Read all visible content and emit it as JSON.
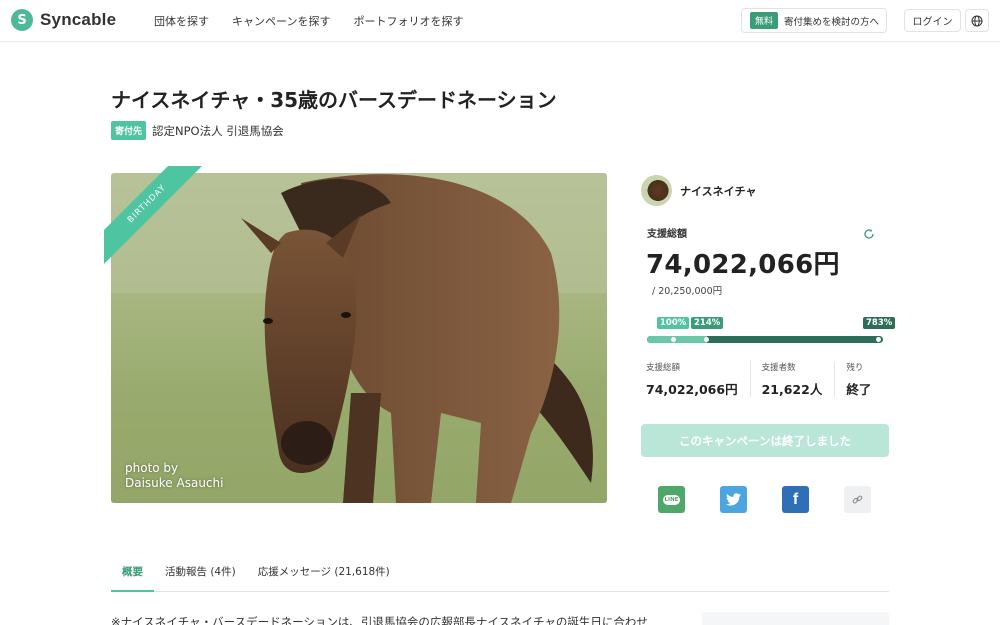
{
  "header": {
    "logo_mark": "S",
    "logo_text": "Syncable",
    "nav": [
      "団体を探す",
      "キャンペーンを探す",
      "ポートフォリオを探す"
    ],
    "cta_badge": "無料",
    "cta_text": "寄付集めを検討の方へ",
    "login": "ログイン",
    "icon": "globe-icon"
  },
  "campaign": {
    "title": "ナイスネイチャ・35歳のバースデードネーション",
    "org_badge": "寄付先",
    "org_name": "認定NPO法人 引退馬協会",
    "ribbon": "BIRTHDAY",
    "photo_credit_1": "photo by",
    "photo_credit_2": "Daisuke Asauchi"
  },
  "panel": {
    "owner_name": "ナイスネイチャ",
    "total_label": "支援総額",
    "total_amount": "74,022,066円",
    "goal": "/ 20,250,000円",
    "progress_percent": 783,
    "milestones": [
      "100%",
      "214%",
      "783%"
    ],
    "stats": [
      {
        "label": "支援総額",
        "value": "74,022,066円"
      },
      {
        "label": "支援者数",
        "value": "21,622人"
      },
      {
        "label": "残り",
        "value": "終了"
      }
    ],
    "ended_button": "このキャンペーンは終了しました",
    "share": {
      "line_label": "LINE"
    },
    "colors": {
      "accent": "#4fc4a0",
      "dark": "#2d6e56"
    }
  },
  "tabs": [
    "概要",
    "活動報告 (4件)",
    "応援メッセージ (21,618件)"
  ],
  "body_text": "※ナイスネイチャ・バースデードネーションは、引退馬協会の広報部長ナイスネイチャの誕生日に合わせ"
}
